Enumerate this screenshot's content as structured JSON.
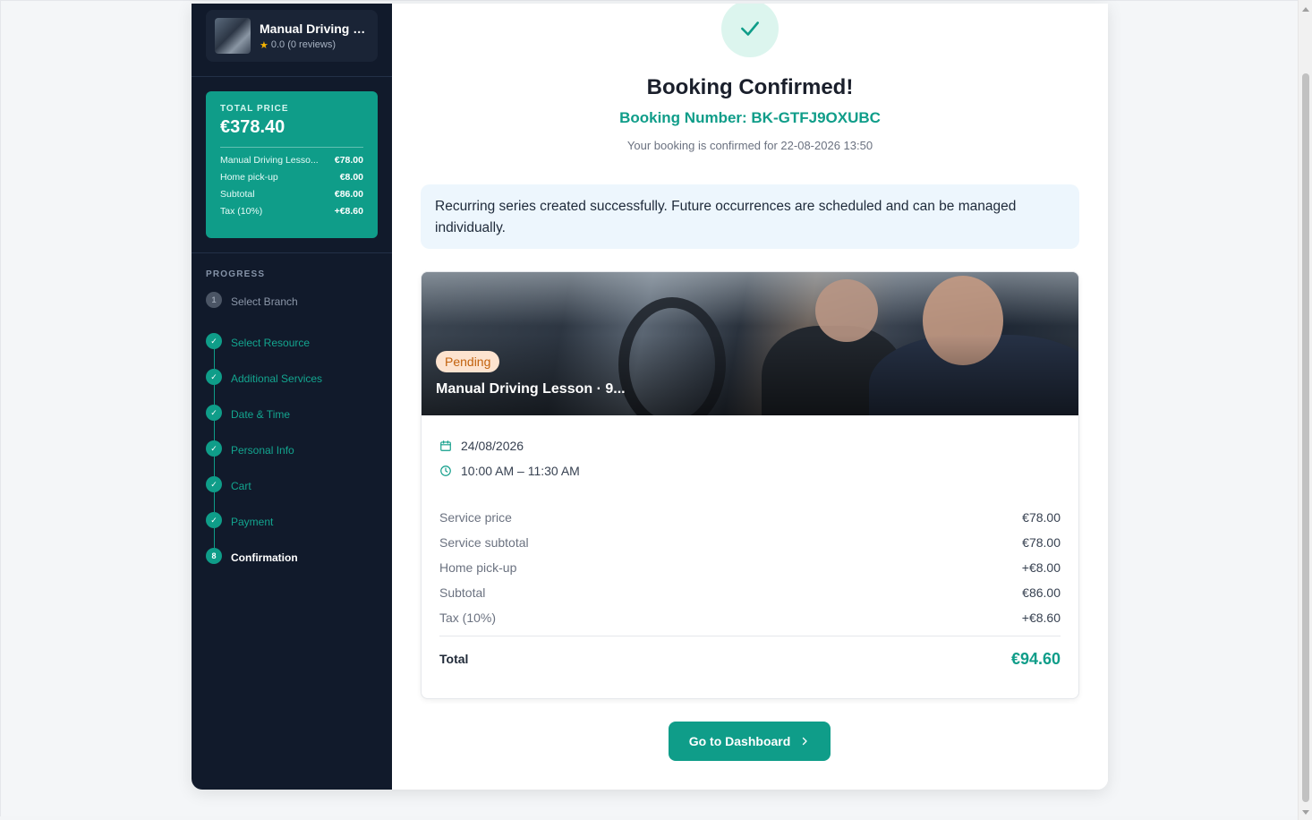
{
  "sidebar": {
    "service": {
      "title": "Manual Driving L...",
      "rating": "0.0 (0 reviews)"
    },
    "price_box": {
      "label": "TOTAL PRICE",
      "total": "€378.40",
      "lines": [
        {
          "label": "Manual Driving Lesso...",
          "value": "€78.00"
        },
        {
          "label": "Home pick-up",
          "value": "€8.00"
        },
        {
          "label": "Subtotal",
          "value": "€86.00"
        },
        {
          "label": "Tax (10%)",
          "value": "+€8.60"
        }
      ]
    },
    "progress_label": "PROGRESS",
    "steps": [
      {
        "number": "1",
        "label": "Select Branch",
        "state": "pending"
      },
      {
        "number": "2",
        "label": "Select Resource",
        "state": "done"
      },
      {
        "number": "3",
        "label": "Additional Services",
        "state": "done"
      },
      {
        "number": "4",
        "label": "Date & Time",
        "state": "done"
      },
      {
        "number": "5",
        "label": "Personal Info",
        "state": "done"
      },
      {
        "number": "6",
        "label": "Cart",
        "state": "done"
      },
      {
        "number": "7",
        "label": "Payment",
        "state": "done"
      },
      {
        "number": "8",
        "label": "Confirmation",
        "state": "current"
      }
    ]
  },
  "main": {
    "headline": "Booking Confirmed!",
    "booking_number": "Booking Number: BK-GTFJ9OXUBC",
    "confirmed_for": "Your booking is confirmed for 22-08-2026 13:50",
    "notice": "Recurring series created successfully. Future occurrences are scheduled and can be managed individually.",
    "booking": {
      "status": "Pending",
      "title": "Manual Driving Lesson · 9...",
      "date": "24/08/2026",
      "time": "10:00 AM – 11:30 AM",
      "price_rows": [
        {
          "label": "Service price",
          "value": "€78.00"
        },
        {
          "label": "Service subtotal",
          "value": "€78.00"
        },
        {
          "label": "Home pick-up",
          "value": "+€8.00"
        },
        {
          "label": "Subtotal",
          "value": "€86.00"
        },
        {
          "label": "Tax (10%)",
          "value": "+€8.60"
        }
      ],
      "total_label": "Total",
      "total_value": "€94.60"
    },
    "dashboard_button": "Go to Dashboard"
  },
  "icons": {
    "check": "check-icon",
    "star": "star-icon",
    "calendar": "calendar-icon",
    "clock": "clock-icon",
    "chevron": "chevron-right-icon"
  },
  "colors": {
    "accent": "#0f9d89",
    "sidebar_bg": "#111a2b",
    "pending_badge_bg": "#fde3cf",
    "pending_badge_text": "#c2620e"
  }
}
